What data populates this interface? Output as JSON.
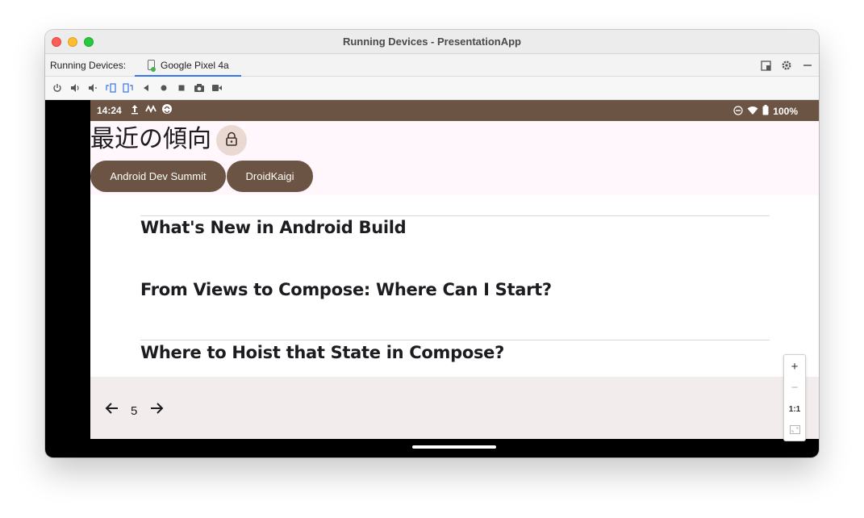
{
  "window": {
    "title": "Running Devices - PresentationApp"
  },
  "tabbar": {
    "label": "Running Devices:",
    "tabs": [
      {
        "label": "Google Pixel 4a",
        "active": true
      }
    ],
    "actions": [
      "layout-icon",
      "gear-icon",
      "minimize-icon"
    ]
  },
  "device_toolbar": {
    "icons": [
      "power-icon",
      "volume-up-icon",
      "volume-down-icon",
      "rotate-left-icon",
      "rotate-right-icon",
      "back-icon",
      "home-icon",
      "overview-icon",
      "screenshot-icon",
      "screen-record-icon"
    ]
  },
  "status_bar": {
    "time": "14:24",
    "battery": "100%"
  },
  "app": {
    "title": "最近の傾向",
    "chips": [
      "Android Dev Summit",
      "DroidKaigi"
    ],
    "talks": [
      "What's New in Android Build",
      "From Views to Compose: Where Can I Start?",
      "Where to Hoist that State in Compose?"
    ],
    "page_number": "5"
  },
  "zoom": {
    "zoom_in": "+",
    "zoom_out": "−",
    "actual_size": "1:1"
  },
  "colors": {
    "status_bar": "#6b5444",
    "chip": "#6b5444",
    "header_bg": "#fff7fb",
    "bottom_bg": "#f3ecec",
    "tab_underline": "#3574f0"
  }
}
